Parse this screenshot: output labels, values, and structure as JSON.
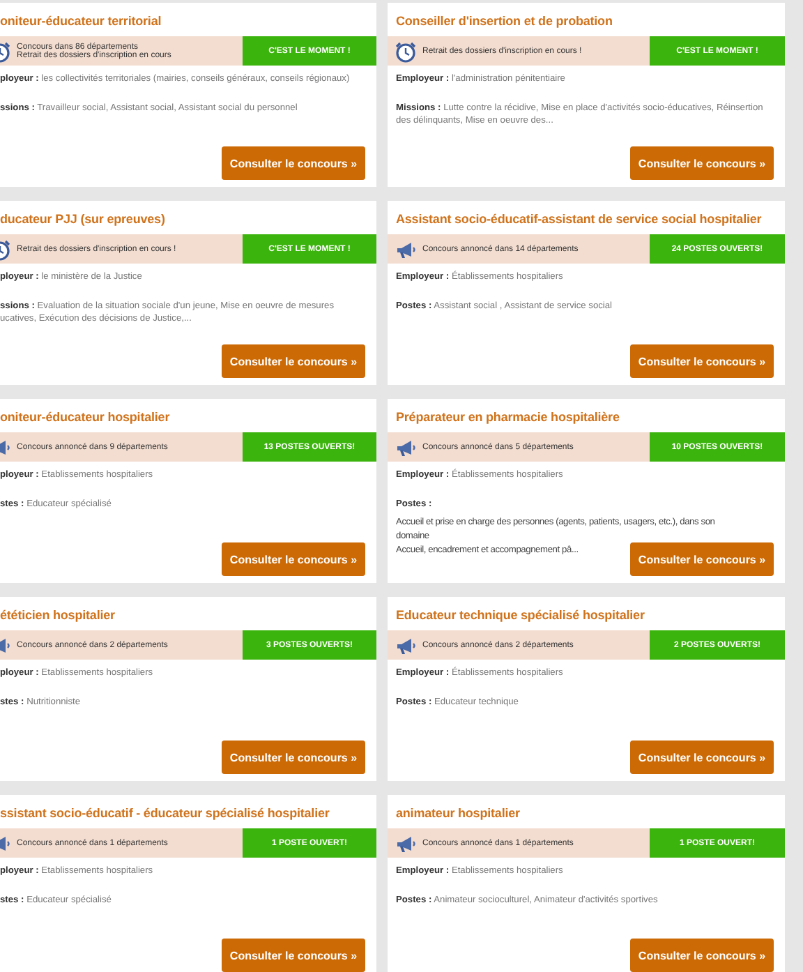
{
  "cards": [
    {
      "title": "oniteur-éducateur territorial",
      "banner": {
        "kind": "retrait",
        "lines": [
          "Concours dans 86 départements",
          "Retrait des dossiers d'inscription en cours"
        ],
        "badge": "C'EST LE MOMENT !"
      },
      "fields": [
        {
          "label": "ployeur :",
          "value": "les collectivités territoriales (mairies, conseils généraux, conseils régionaux)"
        },
        {
          "label": "ssions :",
          "value": "Travailleur social, Assistant social, Assistant social du personnel"
        }
      ],
      "button": "Consulter le concours »"
    },
    {
      "title": "Conseiller d'insertion et de probation",
      "banner": {
        "kind": "retrait",
        "lines": [
          "Retrait des dossiers d'inscription en cours !"
        ],
        "badge": "C'EST LE MOMENT !"
      },
      "fields": [
        {
          "label": "Employeur :",
          "value": "l'administration pénitentiaire"
        },
        {
          "label": "Missions :",
          "value": "Lutte contre la récidive, Mise en place d'activités socio-éducatives, Réinsertion\ndes délinquants, Mise en oeuvre des..."
        }
      ],
      "button": "Consulter le concours »"
    },
    {
      "title": "ducateur PJJ (sur epreuves)",
      "banner": {
        "kind": "retrait",
        "lines": [
          "Retrait des dossiers d'inscription en cours !"
        ],
        "badge": "C'EST LE MOMENT !"
      },
      "fields": [
        {
          "label": "ployeur :",
          "value": "le ministère de la Justice"
        },
        {
          "label": "ssions :",
          "value": "Evaluation de la situation sociale d'un jeune, Mise en oeuvre de mesures\nucatives, Exécution des décisions de Justice,..."
        }
      ],
      "button": "Consulter le concours »"
    },
    {
      "title": "Assistant socio-éducatif-assistant de service social hospitalier",
      "banner": {
        "kind": "annonce",
        "lines": [
          "Concours annoncé dans 14 départements"
        ],
        "badge": "24 POSTES OUVERTS!"
      },
      "fields": [
        {
          "label": "Employeur :",
          "value": "Établissements hospitaliers"
        },
        {
          "label": "Postes :",
          "value": "Assistant social , Assistant de service social"
        }
      ],
      "button": "Consulter le concours »"
    },
    {
      "title": "oniteur-éducateur hospitalier",
      "banner": {
        "kind": "annonce",
        "lines": [
          "Concours annoncé dans 9 départements"
        ],
        "badge": "13 POSTES OUVERTS!"
      },
      "fields": [
        {
          "label": "ployeur :",
          "value": "Etablissements hospitaliers"
        },
        {
          "label": "stes :",
          "value": "Educateur spécialisé"
        }
      ],
      "button": "Consulter le concours »"
    },
    {
      "title": "Préparateur en pharmacie hospitalière",
      "banner": {
        "kind": "annonce",
        "lines": [
          "Concours annoncé dans 5 départements"
        ],
        "badge": "10 POSTES OUVERTS!"
      },
      "fields": [
        {
          "label": "Employeur :",
          "value": "Établissements hospitaliers"
        },
        {
          "label": "Postes :"
        }
      ],
      "description": [
        "Accueil et prise en charge des personnes (agents, patients, usagers, etc.), dans son",
        "domaine",
        "Accueil, encadrement et accompagnement pâ..."
      ],
      "button": "Consulter le concours »"
    },
    {
      "title": "ététicien hospitalier",
      "banner": {
        "kind": "annonce",
        "lines": [
          "Concours annoncé dans 2 départements"
        ],
        "badge": "3 POSTES OUVERTS!"
      },
      "fields": [
        {
          "label": "ployeur :",
          "value": "Etablissements hospitaliers"
        },
        {
          "label": "stes :",
          "value": "Nutritionniste"
        }
      ],
      "button": "Consulter le concours »"
    },
    {
      "title": "Educateur technique spécialisé hospitalier",
      "banner": {
        "kind": "annonce",
        "lines": [
          "Concours annoncé dans 2 départements"
        ],
        "badge": "2 POSTES OUVERTS!"
      },
      "fields": [
        {
          "label": "Employeur :",
          "value": "Établissements hospitaliers"
        },
        {
          "label": "Postes :",
          "value": "Educateur technique"
        }
      ],
      "button": "Consulter le concours »"
    },
    {
      "title": "ssistant socio-éducatif - éducateur spécialisé hospitalier",
      "banner": {
        "kind": "annonce",
        "lines": [
          "Concours annoncé dans 1 départements"
        ],
        "badge": "1 POSTE OUVERT!"
      },
      "fields": [
        {
          "label": "ployeur :",
          "value": "Etablissements hospitaliers"
        },
        {
          "label": "stes :",
          "value": "Educateur spécialisé"
        }
      ],
      "button": "Consulter le concours »"
    },
    {
      "title": "animateur hospitalier",
      "banner": {
        "kind": "annonce",
        "lines": [
          "Concours annoncé dans 1 départements"
        ],
        "badge": "1 POSTE OUVERT!"
      },
      "fields": [
        {
          "label": "Employeur :",
          "value": "Etablissements hospitaliers"
        },
        {
          "label": "Postes :",
          "value": "Animateur socioculturel, Animateur d'activités sportives"
        }
      ],
      "button": "Consulter le concours »"
    }
  ]
}
